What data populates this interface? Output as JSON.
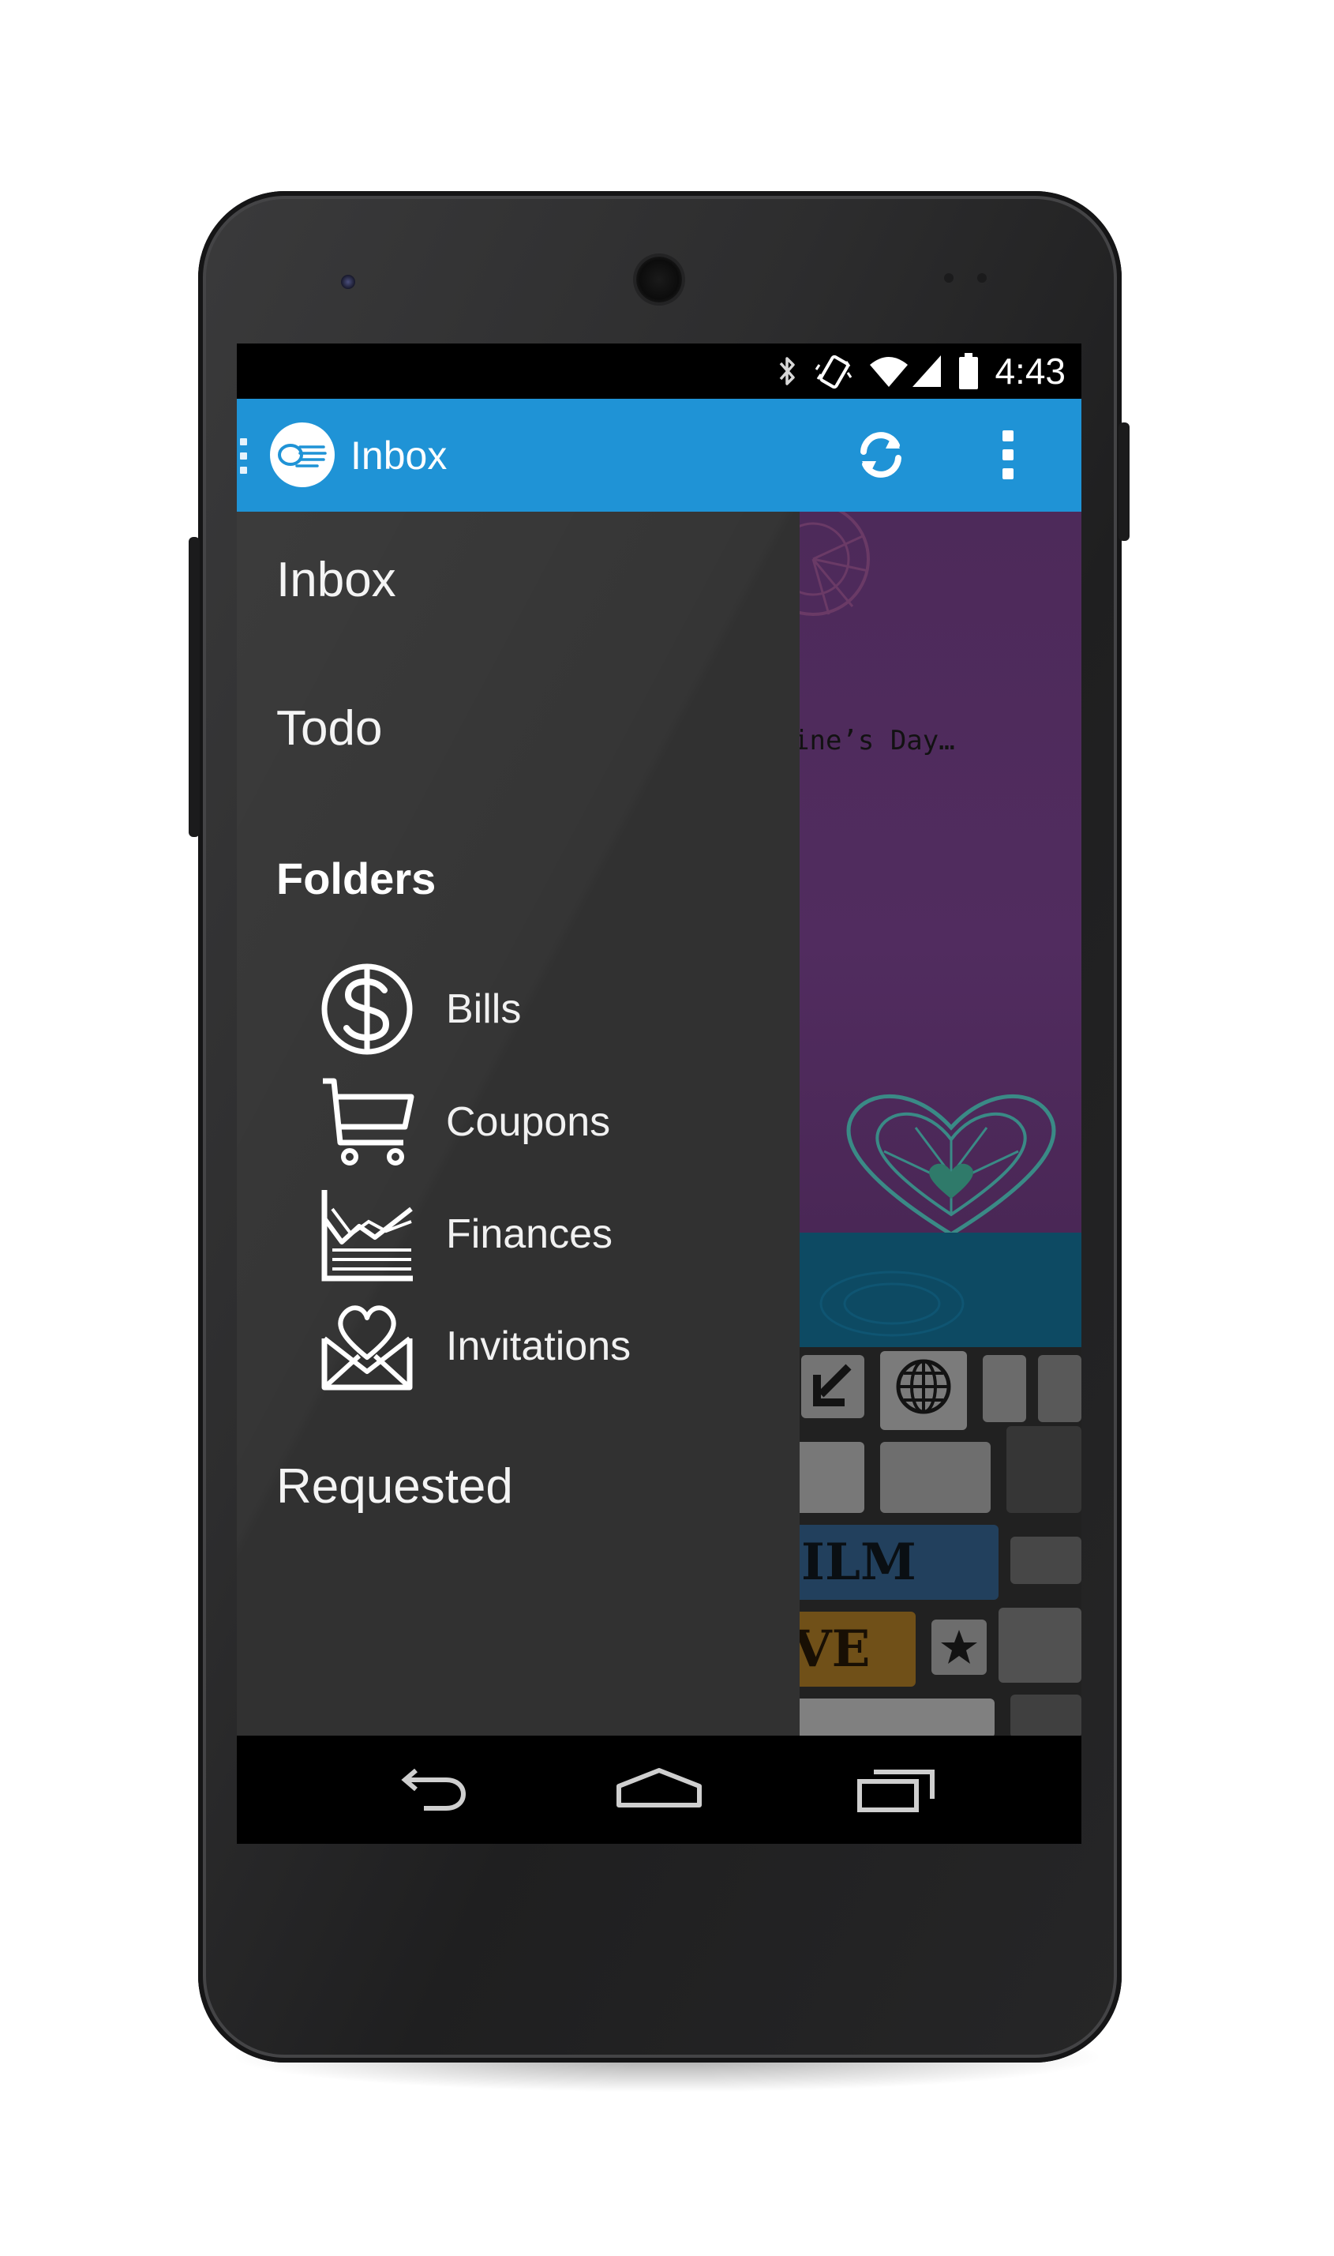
{
  "statusbar": {
    "time": "4:43",
    "icons": [
      "bluetooth-icon",
      "vibrate-icon",
      "wifi-icon",
      "signal-icon",
      "battery-icon"
    ]
  },
  "appbar": {
    "title": "Inbox",
    "actions": [
      "refresh-icon",
      "overflow-menu-icon"
    ]
  },
  "content": {
    "snippet": "ine’s Day…",
    "collage_letters": {
      "film": "ILM",
      "love": "VE"
    }
  },
  "drawer": {
    "items": [
      {
        "label": "Inbox"
      },
      {
        "label": "Todo"
      }
    ],
    "folders_header": "Folders",
    "folders": [
      {
        "label": "Bills",
        "icon": "dollar-icon"
      },
      {
        "label": "Coupons",
        "icon": "shopping-cart-icon"
      },
      {
        "label": "Finances",
        "icon": "chart-icon"
      },
      {
        "label": "Invitations",
        "icon": "heart-envelope-icon"
      }
    ],
    "bottom_item": "Requested"
  },
  "colors": {
    "appbar": "#1f93d6",
    "drawer": "#313131",
    "statusbar": "#000000",
    "purple_card": "#4d2a5a",
    "teal_card": "#0d4a63"
  },
  "navbar": {
    "buttons": [
      "back-icon",
      "home-icon",
      "recents-icon"
    ]
  }
}
